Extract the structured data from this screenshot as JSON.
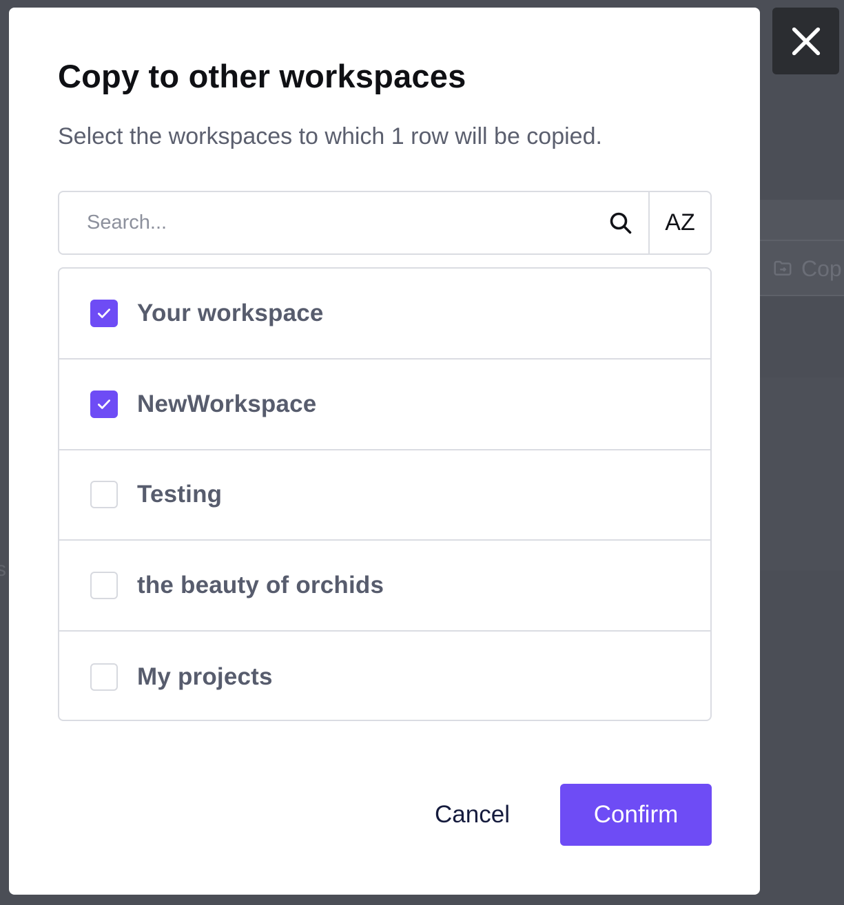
{
  "modal": {
    "title": "Copy to other workspaces",
    "subtitle": "Select the workspaces to which 1 row will be copied."
  },
  "search": {
    "placeholder": "Search...",
    "sort_label": "AZ"
  },
  "workspaces": [
    {
      "label": "Your workspace",
      "checked": true
    },
    {
      "label": "NewWorkspace",
      "checked": true
    },
    {
      "label": "Testing",
      "checked": false
    },
    {
      "label": "the beauty of orchids",
      "checked": false
    },
    {
      "label": "My projects",
      "checked": false
    }
  ],
  "actions": {
    "cancel_label": "Cancel",
    "confirm_label": "Confirm"
  },
  "background": {
    "copy_label": "Cop",
    "left_fragment": "s"
  },
  "colors": {
    "accent": "#6e4cf5",
    "overlay": "#4a4d55",
    "close_bg": "#2b2d31"
  },
  "icons": {
    "close": "close-icon",
    "search": "search-icon",
    "check": "check-icon",
    "copy": "folder-copy-icon"
  }
}
